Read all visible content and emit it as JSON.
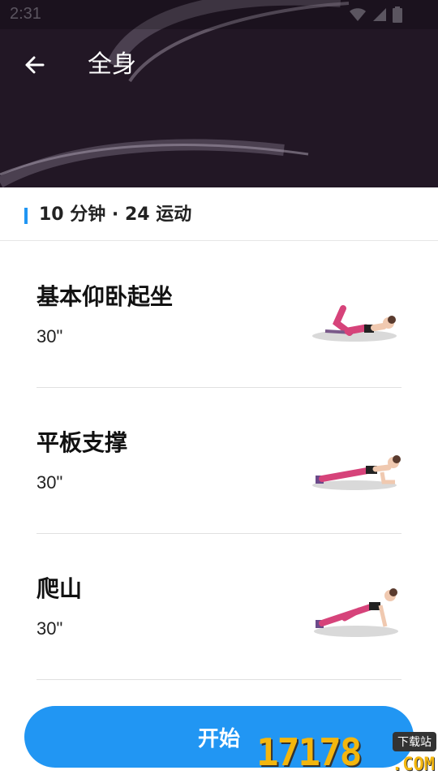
{
  "status_bar": {
    "time": "2:31"
  },
  "header": {
    "title": "全身"
  },
  "summary": {
    "text": "10 分钟 · 24 运动"
  },
  "exercises": [
    {
      "name": "基本仰卧起坐",
      "duration": "30\"",
      "illustration": "crunch-illustration"
    },
    {
      "name": "平板支撑",
      "duration": "30\"",
      "illustration": "plank-illustration"
    },
    {
      "name": "爬山",
      "duration": "30\"",
      "illustration": "mountain-climber-illustration"
    }
  ],
  "start_button": {
    "label": "开始"
  },
  "watermark": {
    "number": "17178",
    "tag": "下载站",
    "suffix": ".COM"
  },
  "colors": {
    "accent": "#2196f3",
    "hero_bg": "#221725",
    "leggings": "#d6437a"
  }
}
